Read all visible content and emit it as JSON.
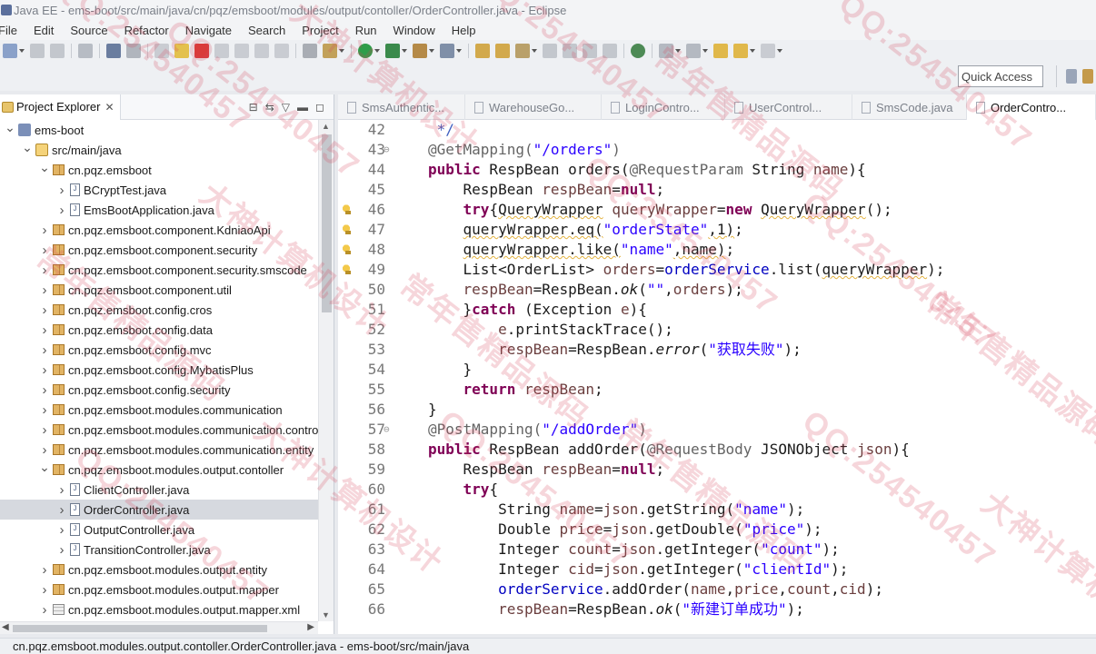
{
  "window": {
    "title": "Java EE - ems-boot/src/main/java/cn/pqz/emsboot/modules/output/contoller/OrderController.java - Eclipse"
  },
  "menu": [
    "File",
    "Edit",
    "Source",
    "Refactor",
    "Navigate",
    "Search",
    "Project",
    "Run",
    "Window",
    "Help"
  ],
  "toolbar": {
    "quick_access": "Quick Access"
  },
  "explorer": {
    "tab_label": "Project Explorer",
    "tab_close": "✕",
    "tree": [
      {
        "label": "ems-boot",
        "icon": "project-icon",
        "level": 0,
        "expanded": true
      },
      {
        "label": "src/main/java",
        "icon": "source-folder-icon",
        "level": 1,
        "expanded": true
      },
      {
        "label": "cn.pqz.emsboot",
        "icon": "package-icon",
        "level": 2,
        "expanded": true
      },
      {
        "label": "BCryptTest.java",
        "icon": "java-file-icon",
        "level": 3,
        "expanded": false
      },
      {
        "label": "EmsBootApplication.java",
        "icon": "java-file-icon",
        "level": 3,
        "expanded": false
      },
      {
        "label": "cn.pqz.emsboot.component.KdniaoApi",
        "icon": "package-icon",
        "level": 2,
        "expanded": false
      },
      {
        "label": "cn.pqz.emsboot.component.security",
        "icon": "package-icon",
        "level": 2,
        "expanded": false
      },
      {
        "label": "cn.pqz.emsboot.component.security.smscode",
        "icon": "package-icon",
        "level": 2,
        "expanded": false
      },
      {
        "label": "cn.pqz.emsboot.component.util",
        "icon": "package-icon",
        "level": 2,
        "expanded": false
      },
      {
        "label": "cn.pqz.emsboot.config.cros",
        "icon": "package-icon",
        "level": 2,
        "expanded": false
      },
      {
        "label": "cn.pqz.emsboot.config.data",
        "icon": "package-icon",
        "level": 2,
        "expanded": false
      },
      {
        "label": "cn.pqz.emsboot.config.mvc",
        "icon": "package-icon",
        "level": 2,
        "expanded": false
      },
      {
        "label": "cn.pqz.emsboot.config.MybatisPlus",
        "icon": "package-icon",
        "level": 2,
        "expanded": false
      },
      {
        "label": "cn.pqz.emsboot.config.security",
        "icon": "package-icon",
        "level": 2,
        "expanded": false
      },
      {
        "label": "cn.pqz.emsboot.modules.communication",
        "icon": "package-icon",
        "level": 2,
        "expanded": false
      },
      {
        "label": "cn.pqz.emsboot.modules.communication.controller",
        "icon": "package-icon",
        "level": 2,
        "expanded": false
      },
      {
        "label": "cn.pqz.emsboot.modules.communication.entity",
        "icon": "package-icon",
        "level": 2,
        "expanded": false
      },
      {
        "label": "cn.pqz.emsboot.modules.output.contoller",
        "icon": "package-icon",
        "level": 2,
        "expanded": true
      },
      {
        "label": "ClientController.java",
        "icon": "java-file-icon",
        "level": 3,
        "expanded": false
      },
      {
        "label": "OrderController.java",
        "icon": "java-file-icon",
        "level": 3,
        "expanded": false,
        "selected": true
      },
      {
        "label": "OutputController.java",
        "icon": "java-file-icon",
        "level": 3,
        "expanded": false
      },
      {
        "label": "TransitionController.java",
        "icon": "java-file-icon",
        "level": 3,
        "expanded": false
      },
      {
        "label": "cn.pqz.emsboot.modules.output.entity",
        "icon": "package-icon",
        "level": 2,
        "expanded": false
      },
      {
        "label": "cn.pqz.emsboot.modules.output.mapper",
        "icon": "package-icon",
        "level": 2,
        "expanded": false
      },
      {
        "label": "cn.pqz.emsboot.modules.output.mapper.xml",
        "icon": "xml-package-icon",
        "level": 2,
        "expanded": false
      }
    ]
  },
  "editor": {
    "tabs": [
      {
        "label": "SmsAuthentic...",
        "active": false
      },
      {
        "label": "WarehouseGo...",
        "active": false
      },
      {
        "label": "LoginContro...",
        "active": false
      },
      {
        "label": "UserControl...",
        "active": false
      },
      {
        "label": "SmsCode.java",
        "active": false
      },
      {
        "label": "OrderContro...",
        "active": true
      }
    ],
    "lines": [
      {
        "n": "42",
        "fold": "",
        "mark": "",
        "segs": [
          [
            "cmt",
            " */"
          ]
        ]
      },
      {
        "n": "43",
        "fold": "⊖",
        "mark": "",
        "segs": [
          [
            "ann",
            "@GetMapping("
          ],
          [
            "str",
            "\"/orders\""
          ],
          [
            "ann",
            ")"
          ]
        ]
      },
      {
        "n": "44",
        "fold": "",
        "mark": "",
        "segs": [
          [
            "kw",
            "public"
          ],
          [
            "",
            " RespBean orders("
          ],
          [
            "ann",
            "@RequestParam"
          ],
          [
            "",
            " String "
          ],
          [
            "lv",
            "name"
          ],
          [
            "",
            "){"
          ]
        ]
      },
      {
        "n": "45",
        "fold": "",
        "mark": "",
        "segs": [
          [
            "",
            "    RespBean "
          ],
          [
            "lv",
            "respBean"
          ],
          [
            "",
            "="
          ],
          [
            "kw",
            "null"
          ],
          [
            "",
            ";"
          ]
        ]
      },
      {
        "n": "46",
        "fold": "",
        "mark": "warn",
        "segs": [
          [
            "",
            "    "
          ],
          [
            "kw",
            "try"
          ],
          [
            "",
            "{"
          ],
          [
            "squig",
            "QueryWrapper"
          ],
          [
            "",
            " "
          ],
          [
            "lv",
            "queryWrapper"
          ],
          [
            "",
            "="
          ],
          [
            "kw",
            "new"
          ],
          [
            "",
            " "
          ],
          [
            "squig",
            "QueryWrapper"
          ],
          [
            "",
            "();"
          ]
        ]
      },
      {
        "n": "47",
        "fold": "",
        "mark": "warn",
        "segs": [
          [
            "",
            "    "
          ],
          [
            "squig",
            "queryWrapper.eq("
          ],
          [
            "str",
            "\"orderState\""
          ],
          [
            "squig",
            ",1)"
          ],
          [
            "",
            ";"
          ]
        ]
      },
      {
        "n": "48",
        "fold": "",
        "mark": "warn",
        "segs": [
          [
            "",
            "    "
          ],
          [
            "squig",
            "queryWrapper.like("
          ],
          [
            "str",
            "\"name\""
          ],
          [
            "squig",
            ",name)"
          ],
          [
            "",
            ";"
          ]
        ]
      },
      {
        "n": "49",
        "fold": "",
        "mark": "warn",
        "segs": [
          [
            "",
            "    List<OrderList> "
          ],
          [
            "lv",
            "orders"
          ],
          [
            "",
            "="
          ],
          [
            "fld",
            "orderService"
          ],
          [
            "",
            ".list("
          ],
          [
            "squig",
            "queryWrapper"
          ],
          [
            "",
            ");"
          ]
        ]
      },
      {
        "n": "50",
        "fold": "",
        "mark": "",
        "segs": [
          [
            "",
            "    "
          ],
          [
            "lv",
            "respBean"
          ],
          [
            "",
            "=RespBean."
          ],
          [
            "it",
            "ok"
          ],
          [
            "",
            "("
          ],
          [
            "str",
            "\"\""
          ],
          [
            "",
            ","
          ],
          [
            "lv",
            "orders"
          ],
          [
            "",
            ");"
          ]
        ]
      },
      {
        "n": "51",
        "fold": "",
        "mark": "",
        "segs": [
          [
            "",
            "    }"
          ],
          [
            "kw",
            "catch"
          ],
          [
            "",
            " (Exception "
          ],
          [
            "lv",
            "e"
          ],
          [
            "",
            "){"
          ]
        ]
      },
      {
        "n": "52",
        "fold": "",
        "mark": "",
        "segs": [
          [
            "",
            "        "
          ],
          [
            "lv",
            "e"
          ],
          [
            "",
            ".printStackTrace();"
          ]
        ]
      },
      {
        "n": "53",
        "fold": "",
        "mark": "",
        "segs": [
          [
            "",
            "        "
          ],
          [
            "lv",
            "respBean"
          ],
          [
            "",
            "=RespBean."
          ],
          [
            "it",
            "error"
          ],
          [
            "",
            "("
          ],
          [
            "str",
            "\"获取失败\""
          ],
          [
            "",
            ");"
          ]
        ]
      },
      {
        "n": "54",
        "fold": "",
        "mark": "",
        "segs": [
          [
            "",
            "    }"
          ]
        ]
      },
      {
        "n": "55",
        "fold": "",
        "mark": "",
        "segs": [
          [
            "",
            "    "
          ],
          [
            "kw",
            "return"
          ],
          [
            "",
            " "
          ],
          [
            "lv",
            "respBean"
          ],
          [
            "",
            ";"
          ]
        ]
      },
      {
        "n": "56",
        "fold": "",
        "mark": "",
        "segs": [
          [
            "",
            "}"
          ]
        ]
      },
      {
        "n": "57",
        "fold": "⊖",
        "mark": "",
        "segs": [
          [
            "ann",
            "@PostMapping("
          ],
          [
            "str",
            "\"/addOrder\""
          ],
          [
            "ann",
            ")"
          ]
        ]
      },
      {
        "n": "58",
        "fold": "",
        "mark": "",
        "segs": [
          [
            "kw",
            "public"
          ],
          [
            "",
            " RespBean addOrder("
          ],
          [
            "ann",
            "@RequestBody"
          ],
          [
            "",
            " JSONObject "
          ],
          [
            "lv",
            "json"
          ],
          [
            "",
            "){"
          ]
        ]
      },
      {
        "n": "59",
        "fold": "",
        "mark": "",
        "segs": [
          [
            "",
            "    RespBean "
          ],
          [
            "lv",
            "respBean"
          ],
          [
            "",
            "="
          ],
          [
            "kw",
            "null"
          ],
          [
            "",
            ";"
          ]
        ]
      },
      {
        "n": "60",
        "fold": "",
        "mark": "",
        "segs": [
          [
            "",
            "    "
          ],
          [
            "kw",
            "try"
          ],
          [
            "",
            "{"
          ]
        ]
      },
      {
        "n": "61",
        "fold": "",
        "mark": "",
        "segs": [
          [
            "",
            "        String "
          ],
          [
            "lv",
            "name"
          ],
          [
            "",
            "="
          ],
          [
            "lv",
            "json"
          ],
          [
            "",
            ".getString("
          ],
          [
            "str",
            "\"name\""
          ],
          [
            "",
            ");"
          ]
        ]
      },
      {
        "n": "62",
        "fold": "",
        "mark": "",
        "segs": [
          [
            "",
            "        Double "
          ],
          [
            "lv",
            "price"
          ],
          [
            "",
            "="
          ],
          [
            "lv",
            "json"
          ],
          [
            "",
            ".getDouble("
          ],
          [
            "str",
            "\"price\""
          ],
          [
            "",
            ");"
          ]
        ]
      },
      {
        "n": "63",
        "fold": "",
        "mark": "",
        "segs": [
          [
            "",
            "        Integer "
          ],
          [
            "lv",
            "count"
          ],
          [
            "",
            "="
          ],
          [
            "lv",
            "json"
          ],
          [
            "",
            ".getInteger("
          ],
          [
            "str",
            "\"count\""
          ],
          [
            "",
            ");"
          ]
        ]
      },
      {
        "n": "64",
        "fold": "",
        "mark": "",
        "segs": [
          [
            "",
            "        Integer "
          ],
          [
            "lv",
            "cid"
          ],
          [
            "",
            "="
          ],
          [
            "lv",
            "json"
          ],
          [
            "",
            ".getInteger("
          ],
          [
            "str",
            "\"clientId\""
          ],
          [
            "",
            ");"
          ]
        ]
      },
      {
        "n": "65",
        "fold": "",
        "mark": "",
        "segs": [
          [
            "",
            "        "
          ],
          [
            "fld",
            "orderService"
          ],
          [
            "",
            ".addOrder("
          ],
          [
            "lv",
            "name"
          ],
          [
            "",
            ","
          ],
          [
            "lv",
            "price"
          ],
          [
            "",
            ","
          ],
          [
            "lv",
            "count"
          ],
          [
            "",
            ","
          ],
          [
            "lv",
            "cid"
          ],
          [
            "",
            ");"
          ]
        ]
      },
      {
        "n": "66",
        "fold": "",
        "mark": "",
        "segs": [
          [
            "",
            "        "
          ],
          [
            "lv",
            "respBean"
          ],
          [
            "",
            "=RespBean."
          ],
          [
            "it",
            "ok"
          ],
          [
            "",
            "("
          ],
          [
            "str",
            "\"新建订单成功\""
          ],
          [
            "",
            ");"
          ]
        ]
      }
    ]
  },
  "statusbar": {
    "text": "cn.pqz.emsboot.modules.output.contoller.OrderController.java - ems-boot/src/main/java"
  },
  "watermark": {
    "texts": [
      "QQ:254540457",
      "大神计算机设计",
      "常年售精品源码"
    ],
    "color": "#d7465a"
  }
}
